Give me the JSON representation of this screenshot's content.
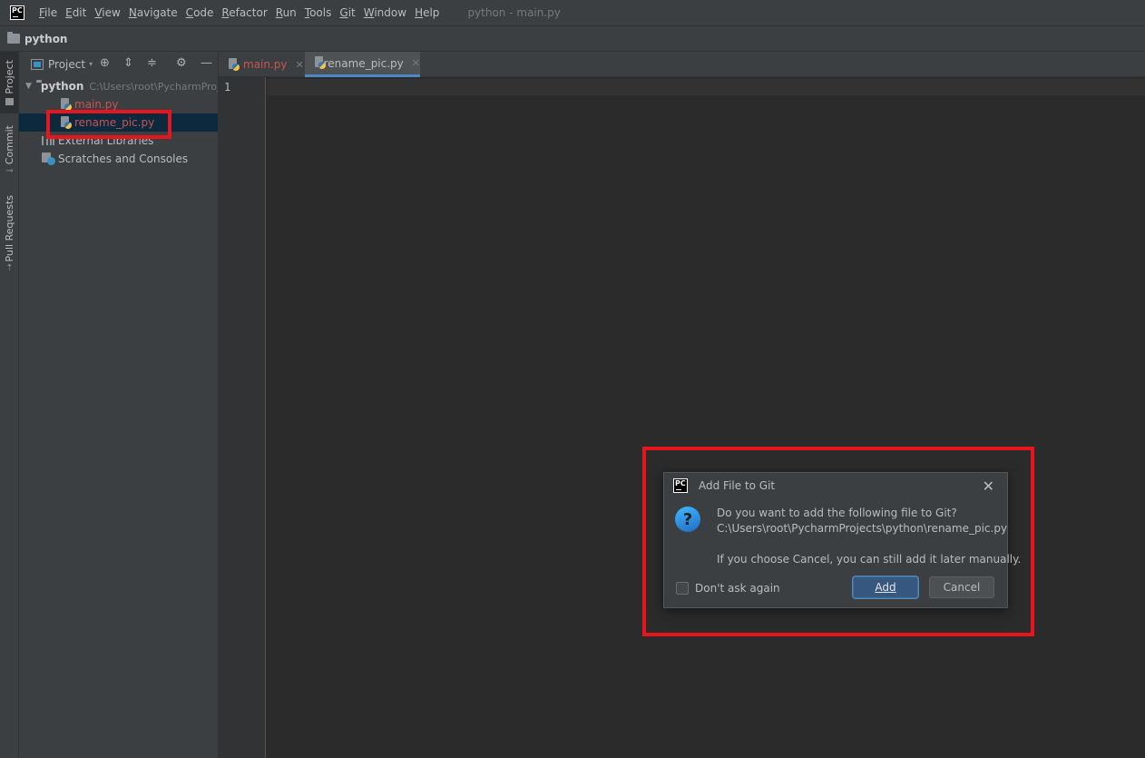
{
  "app_logo": "PC",
  "menu": [
    {
      "label": "File",
      "mnemonic": "F",
      "rest": "ile"
    },
    {
      "label": "Edit",
      "mnemonic": "E",
      "rest": "dit"
    },
    {
      "label": "View",
      "mnemonic": "V",
      "rest": "iew"
    },
    {
      "label": "Navigate",
      "mnemonic": "N",
      "rest": "avigate"
    },
    {
      "label": "Code",
      "mnemonic": "C",
      "rest": "ode"
    },
    {
      "label": "Refactor",
      "mnemonic": "R",
      "rest": "efactor"
    },
    {
      "label": "Run",
      "mnemonic": "R",
      "rest": "un"
    },
    {
      "label": "Tools",
      "mnemonic": "T",
      "rest": "ools"
    },
    {
      "label": "Git",
      "mnemonic": "G",
      "rest": "it"
    },
    {
      "label": "Window",
      "mnemonic": "W",
      "rest": "indow"
    },
    {
      "label": "Help",
      "mnemonic": "H",
      "rest": "elp"
    }
  ],
  "window_title": "python - main.py",
  "navbar": {
    "project": "python"
  },
  "tool_strip": {
    "project": "Project",
    "commit": "Commit",
    "pull_requests": "Pull Requests"
  },
  "project_panel": {
    "title": "Project",
    "root": {
      "name": "python",
      "path": "C:\\Users\\root\\PycharmProjects\\python"
    },
    "files": [
      "main.py",
      "rename_pic.py"
    ],
    "external_libraries": "External Libraries",
    "scratches": "Scratches and Consoles"
  },
  "editor": {
    "tabs": [
      {
        "label": "main.py",
        "active": false
      },
      {
        "label": "rename_pic.py",
        "active": true
      }
    ],
    "line_number": "1"
  },
  "dialog": {
    "title": "Add File to Git",
    "question": "Do you want to add the following file to Git?",
    "path": "C:\\Users\\root\\PycharmProjects\\python\\rename_pic.py",
    "note": "If you choose Cancel, you can still add it later manually.",
    "checkbox_label": "Don't ask again",
    "add_label": "Add",
    "cancel_label": "Cancel"
  },
  "colors": {
    "highlight": "#e8141e",
    "unversioned_file": "#c75450",
    "accent": "#4a88c7"
  }
}
